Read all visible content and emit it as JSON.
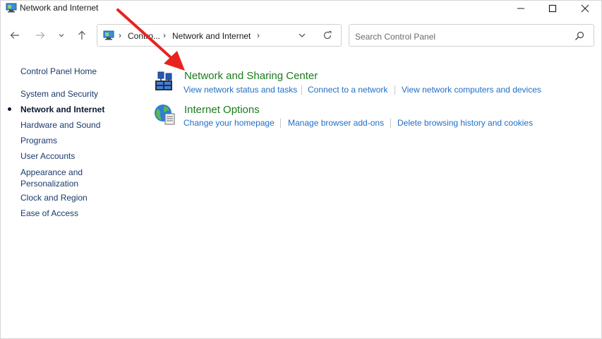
{
  "window": {
    "title": "Network and Internet"
  },
  "navigation": {
    "back_label": "Back",
    "forward_label": "Forward",
    "recent_label": "Recent locations",
    "up_label": "Up"
  },
  "address": {
    "crumbs": [
      "Contro...",
      "Network and Internet"
    ]
  },
  "search": {
    "placeholder": "Search Control Panel"
  },
  "sidebar": {
    "home": "Control Panel Home",
    "items": [
      {
        "label": "System and Security"
      },
      {
        "label": "Network and Internet",
        "current": true
      },
      {
        "label": "Hardware and Sound"
      },
      {
        "label": "Programs"
      },
      {
        "label": "User Accounts"
      },
      {
        "label": "Appearance and",
        "label2": "Personalization"
      },
      {
        "label": "Clock and Region"
      },
      {
        "label": "Ease of Access"
      }
    ]
  },
  "categories": [
    {
      "title": "Network and Sharing Center",
      "icon": "network-sharing-icon",
      "tasks": [
        "View network status and tasks",
        "Connect to a network",
        "View network computers and devices"
      ]
    },
    {
      "title": "Internet Options",
      "icon": "internet-options-icon",
      "tasks": [
        "Change your homepage",
        "Manage browser add-ons",
        "Delete browsing history and cookies"
      ]
    }
  ],
  "colors": {
    "category_title": "#1c7a1c",
    "task_link": "#1f6fc5",
    "annotation_arrow": "#e8231f"
  }
}
